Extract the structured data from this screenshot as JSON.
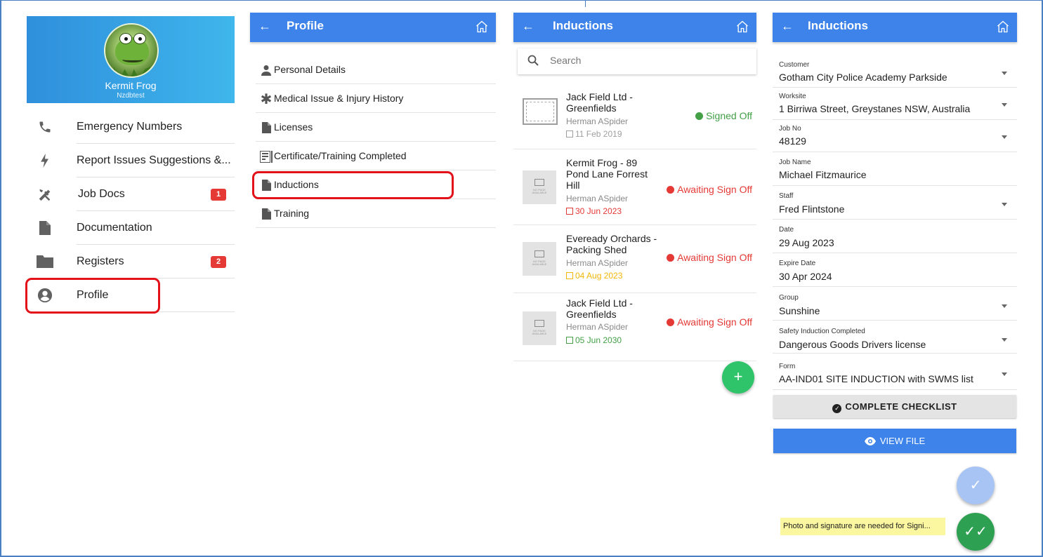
{
  "panel1": {
    "user_name": "Kermit Frog",
    "user_sub": "Nzdbtest",
    "items": [
      {
        "label": "Emergency Numbers",
        "icon": "phone-icon",
        "badge": ""
      },
      {
        "label": "Report Issues Suggestions &...",
        "icon": "lightning-icon",
        "badge": ""
      },
      {
        "label": "Job Docs",
        "icon": "tools-icon",
        "badge": "1"
      },
      {
        "label": "Documentation",
        "icon": "document-icon",
        "badge": ""
      },
      {
        "label": "Registers",
        "icon": "folder-icon",
        "badge": "2"
      },
      {
        "label": "Profile",
        "icon": "account-circle-icon",
        "badge": ""
      }
    ]
  },
  "panel2": {
    "title": "Profile",
    "items": [
      {
        "label": "Personal Details",
        "icon": "person-icon"
      },
      {
        "label": "Medical Issue & Injury History",
        "icon": "asterisk-icon"
      },
      {
        "label": "Licenses",
        "icon": "file-icon"
      },
      {
        "label": "Certificate/Training Completed",
        "icon": "certificate-icon"
      },
      {
        "label": "Inductions",
        "icon": "file-icon"
      },
      {
        "label": "Training",
        "icon": "file-icon"
      }
    ]
  },
  "panel3": {
    "title": "Inductions",
    "search_placeholder": "Search",
    "rows": [
      {
        "name": "Jack Field Ltd - Greenfields",
        "person": "Herman ASpider",
        "date": "11 Feb 2019",
        "date_color": "#9e9e9e",
        "status": "Signed Off",
        "status_color": "#43a047"
      },
      {
        "name": "Kermit Frog - 89 Pond Lane Forrest Hill",
        "person": "Herman ASpider",
        "date": "30 Jun 2023",
        "date_color": "#e53935",
        "status": "Awaiting Sign Off",
        "status_color": "#e53935"
      },
      {
        "name": "Eveready Orchards - Packing Shed",
        "person": "Herman ASpider",
        "date": "04 Aug 2023",
        "date_color": "#f2b705",
        "status": "Awaiting Sign Off",
        "status_color": "#e53935"
      },
      {
        "name": "Jack Field Ltd - Greenfields",
        "person": "Herman ASpider",
        "date": "05 Jun 2030",
        "date_color": "#43a047",
        "status": "Awaiting Sign Off",
        "status_color": "#e53935"
      }
    ],
    "thumb_text": "NO PAGE AVAILABLE",
    "fab_label": "+"
  },
  "panel4": {
    "title": "Inductions",
    "fields": [
      {
        "label": "Customer",
        "value": "Gotham City Police Academy Parkside",
        "dropdown": true
      },
      {
        "label": "Worksite",
        "value": "1 Birriwa Street, Greystanes NSW, Australia",
        "dropdown": true
      },
      {
        "label": "Job No",
        "value": "48129",
        "dropdown": true
      },
      {
        "label": "Job Name",
        "value": "Michael Fitzmaurice",
        "dropdown": false
      },
      {
        "label": "Staff",
        "value": "Fred Flintstone",
        "dropdown": true
      },
      {
        "label": "Date",
        "value": "29 Aug 2023",
        "dropdown": false
      },
      {
        "label": "Expire Date",
        "value": "30 Apr 2024",
        "dropdown": false
      },
      {
        "label": "Group",
        "value": "Sunshine",
        "dropdown": true
      },
      {
        "label": "Safety Induction Completed",
        "value": "Dangerous Goods Drivers license",
        "dropdown": true
      },
      {
        "label": "Form",
        "value": "AA-IND01 SITE INDUCTION with SWMS list",
        "dropdown": true
      }
    ],
    "complete_checklist": "COMPLETE CHECKLIST",
    "view_file": "VIEW FILE",
    "toast": "Photo and signature are needed for Signi..."
  },
  "colors": {
    "appbar": "#3d83ea",
    "drawer_header": "#3fb6ec",
    "highlight": "#e3121a",
    "signed": "#43a047",
    "awaiting": "#e53935",
    "fab_green": "#2ea052"
  }
}
